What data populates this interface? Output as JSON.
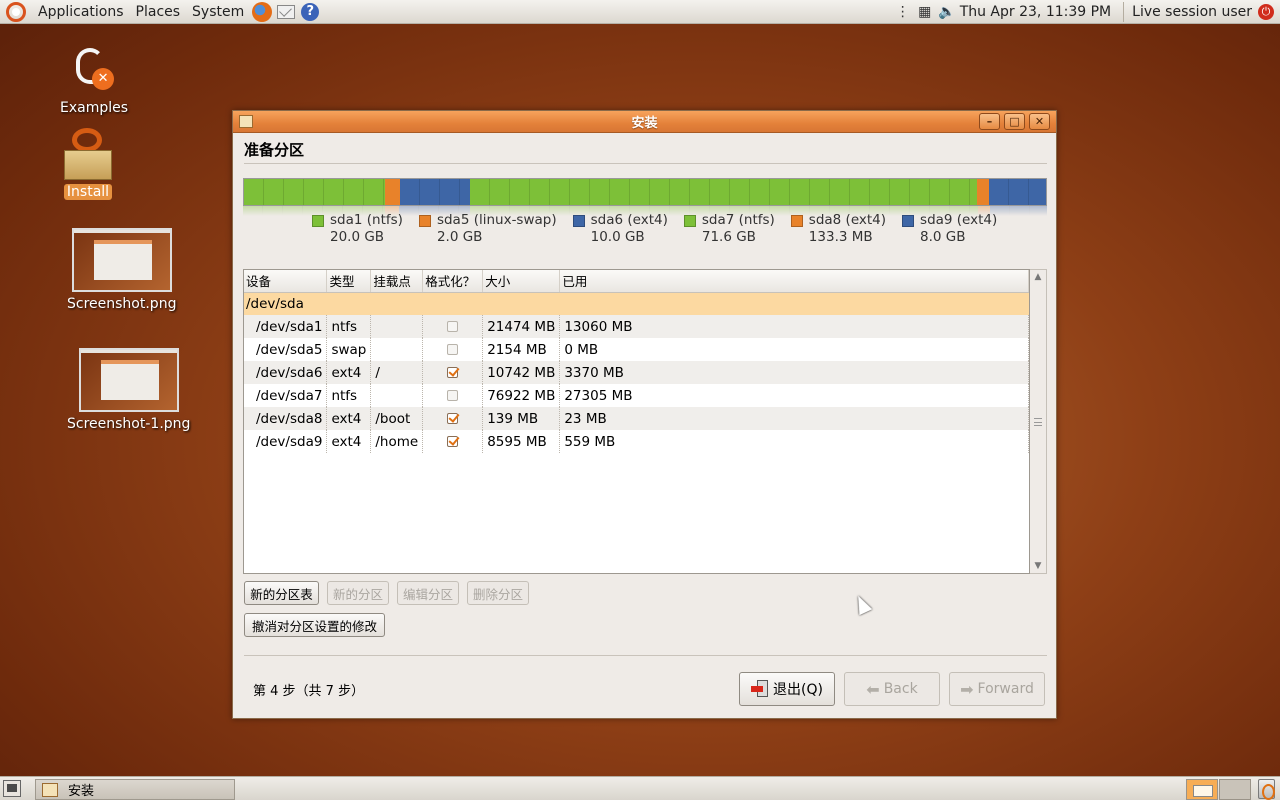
{
  "top_panel": {
    "menus": [
      "Applications",
      "Places",
      "System"
    ],
    "clock": "Thu Apr 23, 11:39 PM",
    "session_user": "Live session user"
  },
  "desktop_icons": [
    {
      "label": "Examples"
    },
    {
      "label": "Install"
    },
    {
      "label": "Screenshot.png"
    },
    {
      "label": "Screenshot-1.png"
    }
  ],
  "dialog": {
    "title": "安装",
    "heading": "准备分区",
    "partitions_bar": [
      {
        "name": "sda1 (ntfs)",
        "size": "20.0 GB",
        "color": "#7dc038",
        "gb": 20.0
      },
      {
        "name": "sda5 (linux-swap)",
        "size": "2.0 GB",
        "color": "#e8822a",
        "gb": 2.0
      },
      {
        "name": "sda6 (ext4)",
        "size": "10.0 GB",
        "color": "#3e66a6",
        "gb": 10.0
      },
      {
        "name": "sda7 (ntfs)",
        "size": "71.6 GB",
        "color": "#7dc038",
        "gb": 71.6
      },
      {
        "name": "sda8 (ext4)",
        "size": "133.3 MB",
        "color": "#e8822a",
        "gb": 0.1333
      },
      {
        "name": "sda9 (ext4)",
        "size": "8.0 GB",
        "color": "#3e66a6",
        "gb": 8.0
      }
    ],
    "table": {
      "headers": [
        "设备",
        "类型",
        "挂载点",
        "格式化？",
        "大小",
        "已用"
      ],
      "disk_row": "/dev/sda",
      "rows": [
        {
          "device": "/dev/sda1",
          "type": "ntfs",
          "mount": "",
          "format": false,
          "size": "21474 MB",
          "used": "13060 MB"
        },
        {
          "device": "/dev/sda5",
          "type": "swap",
          "mount": "",
          "format": false,
          "size": "2154 MB",
          "used": "0 MB"
        },
        {
          "device": "/dev/sda6",
          "type": "ext4",
          "mount": "/",
          "format": true,
          "size": "10742 MB",
          "used": "3370 MB"
        },
        {
          "device": "/dev/sda7",
          "type": "ntfs",
          "mount": "",
          "format": false,
          "size": "76922 MB",
          "used": "27305 MB"
        },
        {
          "device": "/dev/sda8",
          "type": "ext4",
          "mount": "/boot",
          "format": true,
          "size": "139 MB",
          "used": "23 MB"
        },
        {
          "device": "/dev/sda9",
          "type": "ext4",
          "mount": "/home",
          "format": true,
          "size": "8595 MB",
          "used": "559 MB"
        }
      ]
    },
    "buttons": {
      "new_table": "新的分区表",
      "new_partition": "新的分区",
      "edit_partition": "编辑分区",
      "delete_partition": "删除分区",
      "revert": "撤消对分区设置的修改"
    },
    "step": "第 4 步（共 7 步）",
    "nav": {
      "quit": "退出(Q)",
      "back": "Back",
      "forward": "Forward"
    }
  },
  "taskbar": {
    "task_label": "安装"
  }
}
